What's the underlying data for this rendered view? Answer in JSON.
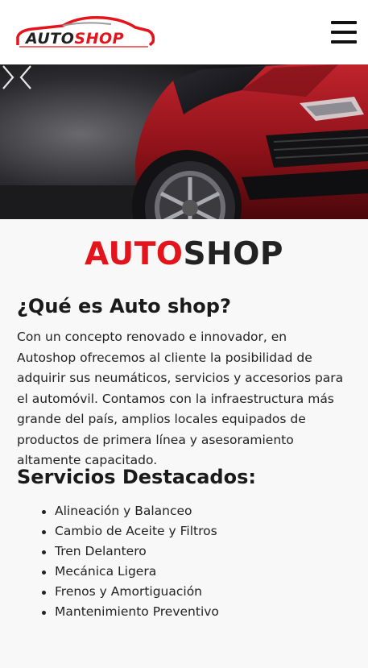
{
  "header": {
    "logo_part1": "AUTO",
    "logo_part2": "SHOP",
    "menu_icon": "hamburger-icon"
  },
  "carousel": {
    "prev_icon": "chevron-left-icon",
    "next_icon": "chevron-right-icon"
  },
  "brand": {
    "part1": "AUTO",
    "part2": "SHOP"
  },
  "about": {
    "heading": "¿Qué es Auto shop?",
    "paragraph": "Con un concepto renovado e innovador, en Autoshop ofrecemos al cliente la posibilidad de adquirir sus neumáticos, servicios y accesorios para el automóvil. Contamos con la infraestructura más grande del país, amplios locales equipados de productos de primera línea y asesoramiento altamente capacitado."
  },
  "services": {
    "heading": "Servicios Destacados:",
    "items": [
      "Alineación y Balanceo",
      "Cambio de Aceite y Filtros",
      "Tren Delantero",
      "Mecánica Ligera",
      "Frenos y Amortiguación",
      "Mantenimiento Preventivo"
    ]
  },
  "colors": {
    "accent": "#e3141b",
    "dark": "#222222",
    "background": "#f8f8f8"
  }
}
